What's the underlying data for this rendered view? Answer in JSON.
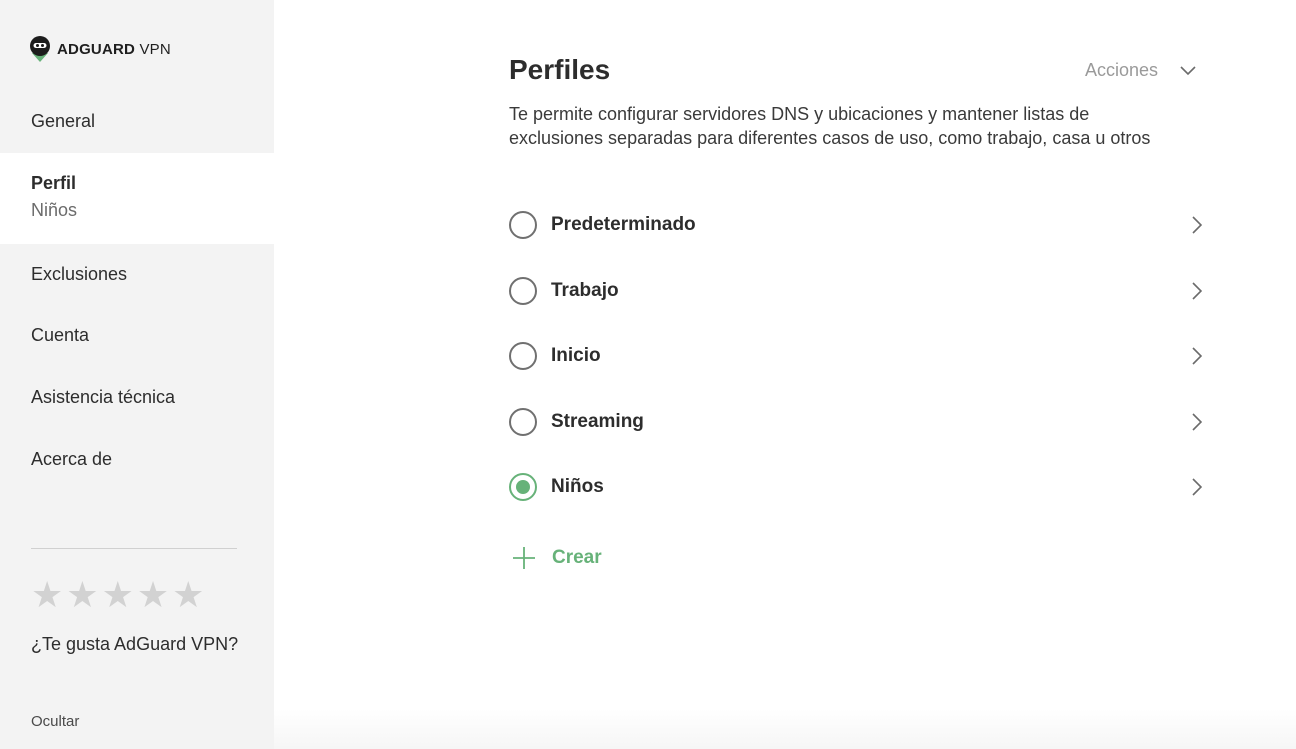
{
  "brand": {
    "name_bold": "ADGUARD",
    "name_light": "VPN"
  },
  "sidebar": {
    "items": [
      {
        "label": "General"
      },
      {
        "label": "Perfil",
        "sub": "Niños"
      },
      {
        "label": "Exclusiones"
      },
      {
        "label": "Cuenta"
      },
      {
        "label": "Asistencia técnica"
      },
      {
        "label": "Acerca de"
      }
    ],
    "rating": {
      "stars": 5,
      "filled": 0,
      "question": "¿Te gusta AdGuard VPN?",
      "hide_label": "Ocultar"
    }
  },
  "main": {
    "title": "Perfiles",
    "actions_label": "Acciones",
    "description": "Te permite configurar servidores DNS y ubicaciones y mantener listas de exclusiones separadas para diferentes casos de uso, como trabajo, casa u otros",
    "profiles": [
      {
        "name": "Predeterminado",
        "selected": false
      },
      {
        "name": "Trabajo",
        "selected": false
      },
      {
        "name": "Inicio",
        "selected": false
      },
      {
        "name": "Streaming",
        "selected": false
      },
      {
        "name": "Niños",
        "selected": true
      }
    ],
    "create_label": "Crear"
  },
  "colors": {
    "accent": "#67b279",
    "sidebar_bg": "#f3f3f3",
    "muted": "#9a9a9a"
  },
  "icons": {
    "logo": "adguard-shield-icon",
    "chevron_down": "chevron-down-icon",
    "chevron_right": "chevron-right-icon",
    "plus": "plus-icon",
    "star": "star-icon"
  }
}
